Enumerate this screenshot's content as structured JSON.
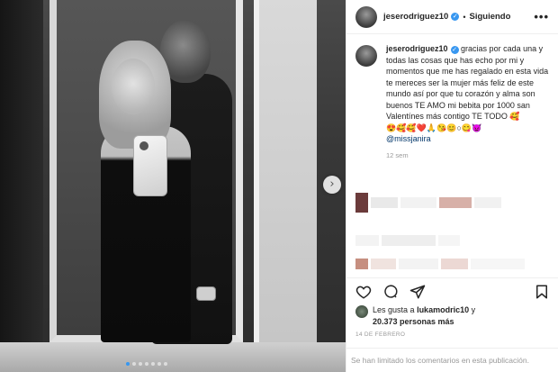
{
  "post": {
    "username": "jeserodriguez10",
    "separator": "•",
    "follow_status": "Siguiendo",
    "more_label": "•••",
    "next_glyph": "›",
    "caption": "gracias por cada una y todas las cosas que has echo por mi y momentos que me has regalado en esta vida te mereces ser la mujer más feliz de este mundo así por que tu corazón y alma son buenos TE AMO mi bebita por 1000 san Valentínes más contigo TE TODO 🥰",
    "emoji_line": "😍🥰🥰❤️🙏😘😊○😋👿",
    "mention": "@missjanira",
    "time_ago": "12 sem",
    "likes_prefix": "Les gusta a",
    "likes_user": "lukamodric10",
    "likes_conj": "y",
    "likes_count": "20.373 personas más",
    "date": "14 DE FEBRERO",
    "comments_disabled": "Se han limitado los comentarios en esta publicación."
  },
  "colors": {
    "accent": "#3897f0",
    "like_icon": "#262626",
    "muted": "#999999"
  },
  "icons": [
    "heart-icon",
    "comment-icon",
    "share-icon",
    "bookmark-icon",
    "verified-icon",
    "more-options-icon",
    "next-arrow-icon"
  ]
}
